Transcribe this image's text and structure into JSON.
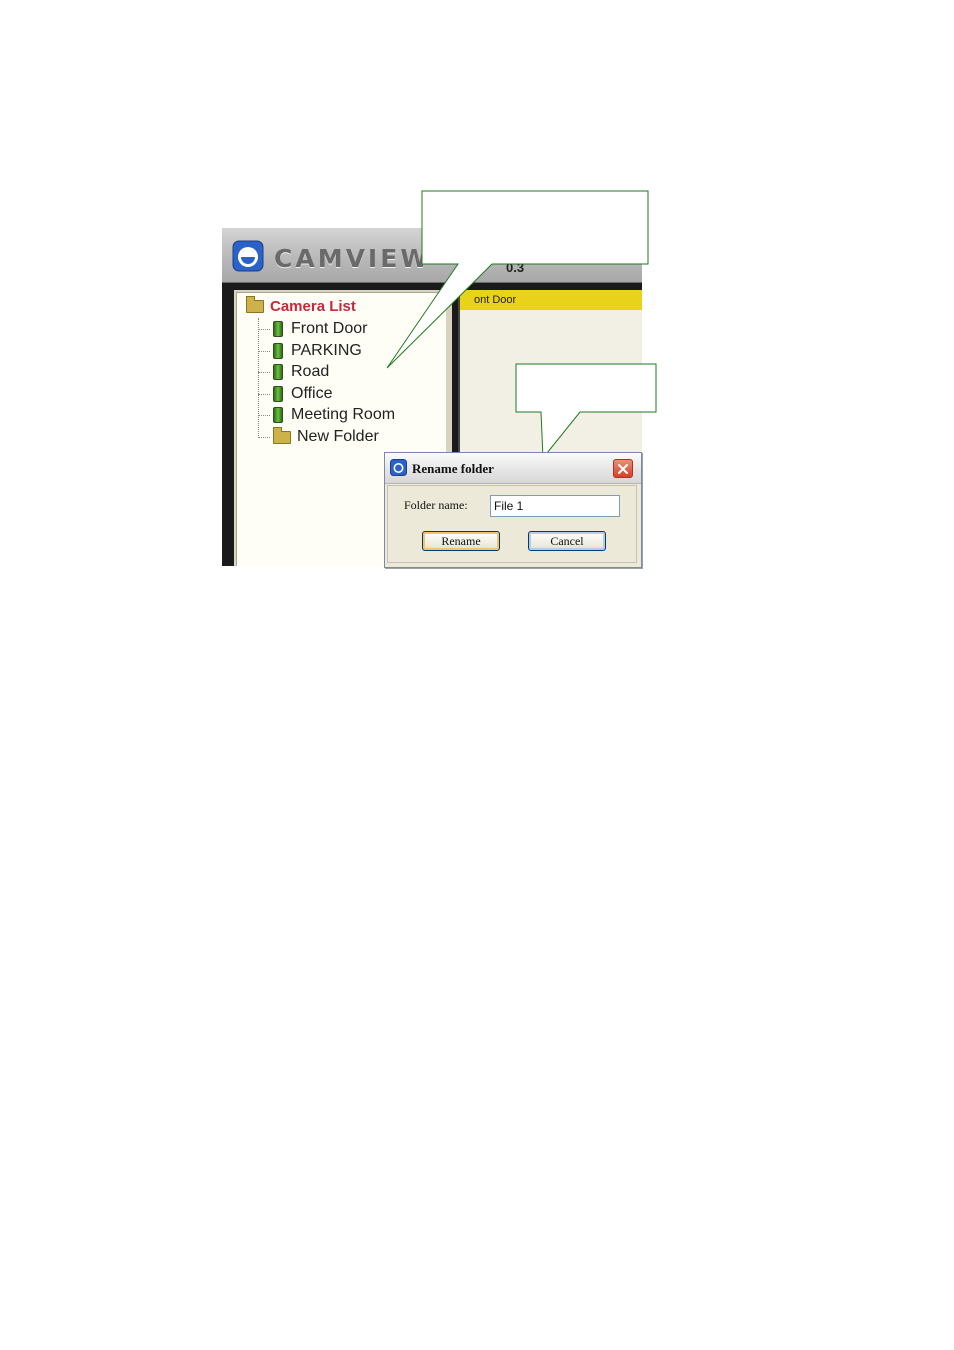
{
  "app": {
    "logo_text": "CAMVIEW",
    "version_fragment": "0.3"
  },
  "tree": {
    "root_label": "Camera List",
    "items": [
      {
        "label": "Front Door",
        "type": "camera"
      },
      {
        "label": "PARKING",
        "type": "camera"
      },
      {
        "label": "Road",
        "type": "camera"
      },
      {
        "label": "Office",
        "type": "camera"
      },
      {
        "label": "Meeting Room",
        "type": "camera"
      },
      {
        "label": "New Folder",
        "type": "folder"
      }
    ]
  },
  "view": {
    "title_fragment": "ont Door"
  },
  "dialog": {
    "title": "Rename folder",
    "field_label": "Folder name:",
    "field_value": "File 1",
    "rename_label": "Rename",
    "cancel_label": "Cancel"
  },
  "colors": {
    "root_label": "#c8283c",
    "view_titlebar": "#e8d21a",
    "callout_border": "#1f7a1f",
    "close_button": "#d6402a"
  },
  "icons": {
    "logo": "camview-logo-icon",
    "camera": "camera-icon",
    "folder": "folder-icon",
    "close": "close-icon"
  }
}
